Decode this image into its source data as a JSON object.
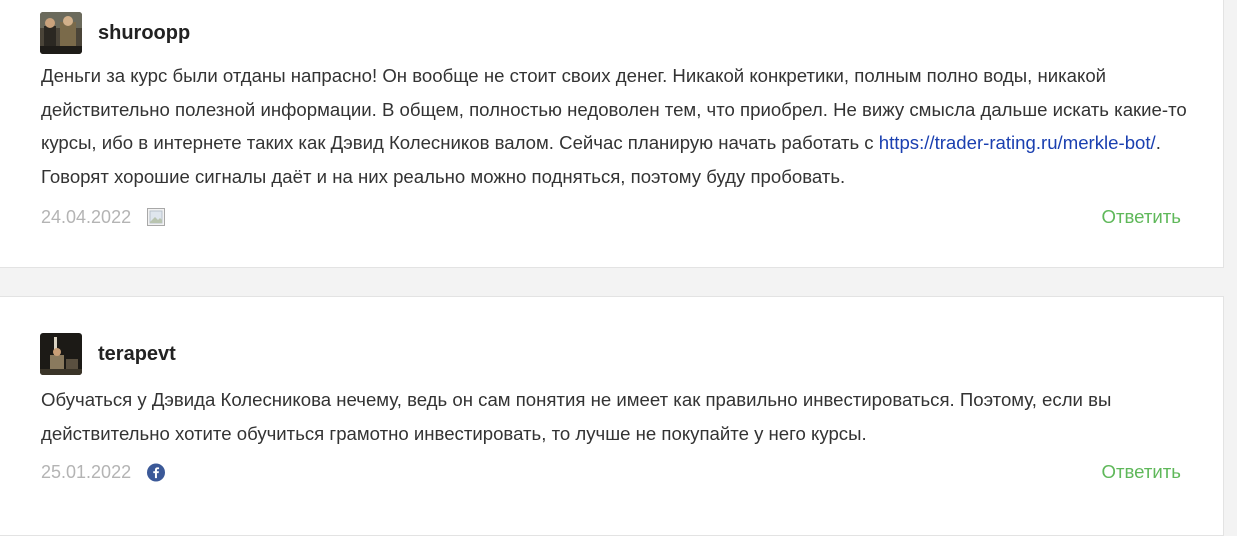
{
  "comments": [
    {
      "username": "shuroopp",
      "text_before_link": "Деньги за курс были отданы напрасно! Он вообще не стоит своих денег. Никакой конкретики, полным полно воды, никакой действительно полезной информации. В общем, полностью недоволен тем, что приобрел. Не вижу смысла дальше искать какие-то курсы, ибо в интернете таких как Дэвид Колесников валом. Сейчас планирую начать работать с ",
      "link_text": "https://trader-rating.ru/merkle-bot/",
      "text_after_link": ". Говорят хорошие сигналы даёт и на них реально можно подняться, поэтому буду пробовать.",
      "date": "24.04.2022",
      "source_icon": "image-placeholder-icon",
      "reply_label": "Ответить"
    },
    {
      "username": "terapevt",
      "text": "Обучаться у Дэвида Колесникова нечему, ведь он сам понятия не имеет как правильно инвестироваться. Поэтому, если вы действительно хотите обучиться грамотно инвестировать, то лучше не покупайте у него курсы.",
      "date": "25.01.2022",
      "source_icon": "facebook-icon",
      "reply_label": "Ответить"
    }
  ],
  "colors": {
    "link": "#1a3fb0",
    "reply": "#5fb85a",
    "date": "#b4b4b4",
    "facebook": "#3b5998"
  }
}
